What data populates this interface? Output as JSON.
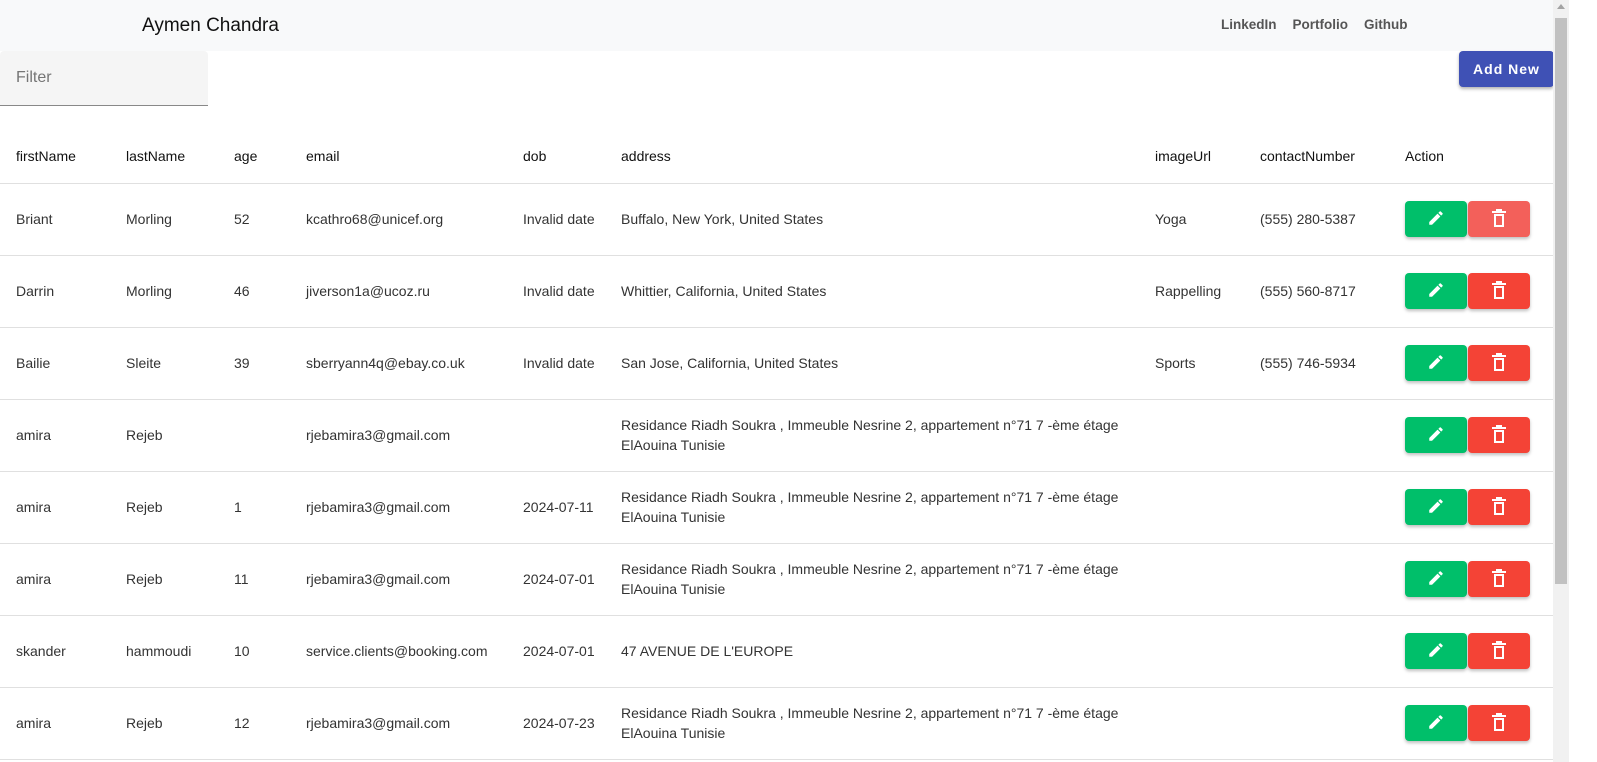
{
  "nav": {
    "brand": "Aymen Chandra",
    "links": [
      "LinkedIn",
      "Portfolio",
      "Github"
    ]
  },
  "filter": {
    "placeholder": "Filter",
    "value": ""
  },
  "add_button": "Add New",
  "columns": [
    "firstName",
    "lastName",
    "age",
    "email",
    "dob",
    "address",
    "imageUrl",
    "contactNumber",
    "Action"
  ],
  "rows": [
    [
      "Briant",
      "Morling",
      "52",
      "kcathro68@unicef.org",
      "Invalid date",
      "Buffalo, New York, United States",
      "Yoga",
      "(555) 280-5387"
    ],
    [
      "Darrin",
      "Morling",
      "46",
      "jiverson1a@ucoz.ru",
      "Invalid date",
      "Whittier, California, United States",
      "Rappelling",
      "(555) 560-8717"
    ],
    [
      "Bailie",
      "Sleite",
      "39",
      "sberryann4q@ebay.co.uk",
      "Invalid date",
      "San Jose, California, United States",
      "Sports",
      "(555) 746-5934"
    ],
    [
      "amira",
      "Rejeb",
      "",
      "rjebamira3@gmail.com",
      "",
      "Residance Riadh Soukra , Immeuble Nesrine 2, appartement n°71 7 -ème étage ElAouina Tunisie",
      "",
      ""
    ],
    [
      "amira",
      "Rejeb",
      "1",
      "rjebamira3@gmail.com",
      "2024-07-11",
      "Residance Riadh Soukra , Immeuble Nesrine 2, appartement n°71 7 -ème étage ElAouina Tunisie",
      "",
      ""
    ],
    [
      "amira",
      "Rejeb",
      "11",
      "rjebamira3@gmail.com",
      "2024-07-01",
      "Residance Riadh Soukra , Immeuble Nesrine 2, appartement n°71 7 -ème étage ElAouina Tunisie",
      "",
      ""
    ],
    [
      "skander",
      "hammoudi",
      "10",
      "service.clients@booking.com",
      "2024-07-01",
      "47 AVENUE DE L'EUROPE",
      "",
      ""
    ],
    [
      "amira",
      "Rejeb",
      "12",
      "rjebamira3@gmail.com",
      "2024-07-23",
      "Residance Riadh Soukra , Immeuble Nesrine 2, appartement n°71 7 -ème étage ElAouina Tunisie",
      "",
      ""
    ]
  ],
  "colors": {
    "edit": "#00bf6a",
    "delete": "#f44336",
    "add": "#3f51b5"
  }
}
